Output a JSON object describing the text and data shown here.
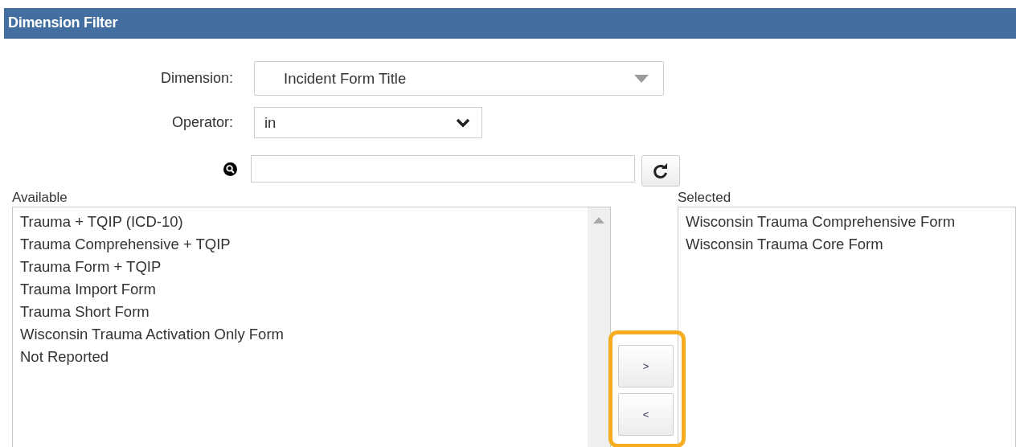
{
  "header": {
    "title": "Dimension Filter"
  },
  "fields": [
    {
      "kind": "combo",
      "label": "Dimension:",
      "value": "Incident Form Title"
    },
    {
      "kind": "select",
      "label": "Operator:",
      "value": "in"
    }
  ],
  "available": {
    "label": "Available",
    "items": [
      "Trauma + TQIP (ICD-10)",
      "Trauma Comprehensive + TQIP",
      "Trauma Form + TQIP",
      "Trauma Import Form",
      "Trauma Short Form",
      "Wisconsin Trauma Activation Only Form",
      "Not Reported"
    ]
  },
  "move_buttons": [
    ">",
    "<"
  ],
  "selected": {
    "label": "Selected",
    "items": [
      "Wisconsin Trauma Comprehensive Form",
      "Wisconsin Trauma Core Form"
    ]
  }
}
